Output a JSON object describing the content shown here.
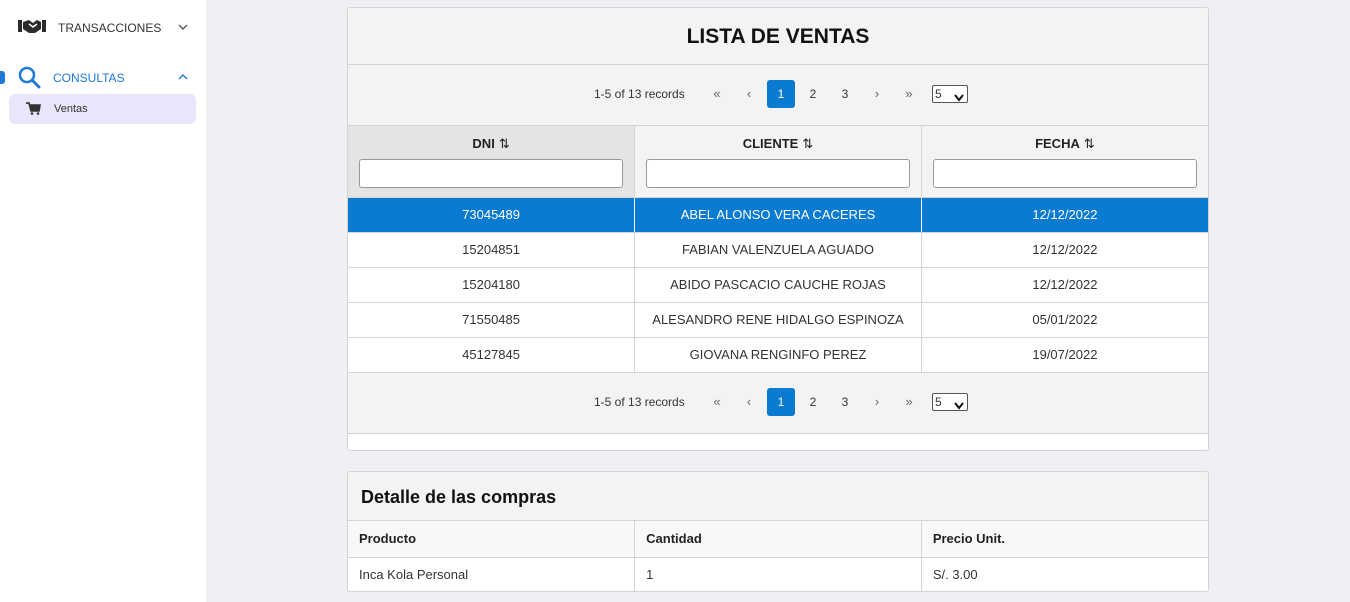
{
  "sidebar": {
    "transacciones": "TRANSACCIONES",
    "consultas": "CONSULTAS",
    "ventas": "Ventas"
  },
  "colors": {
    "accent": "#0b7ad1",
    "sidebar_active_bg": "#e8e6fb"
  },
  "sales": {
    "title": "LISTA DE VENTAS",
    "paginator": {
      "records": "1-5 of 13 records",
      "first": "«",
      "prev": "‹",
      "next": "›",
      "last": "»",
      "pages": [
        "1",
        "2",
        "3"
      ],
      "current_page": "1",
      "rows_per_page": "5"
    },
    "columns": [
      "DNI",
      "CLIENTE",
      "FECHA"
    ],
    "sort_icon": "⇅",
    "rows": [
      {
        "dni": "73045489",
        "cliente": "ABEL ALONSO VERA CACERES",
        "fecha": "12/12/2022",
        "selected": true
      },
      {
        "dni": "15204851",
        "cliente": "FABIAN VALENZUELA AGUADO",
        "fecha": "12/12/2022"
      },
      {
        "dni": "15204180",
        "cliente": "ABIDO PASCACIO CAUCHE ROJAS",
        "fecha": "12/12/2022"
      },
      {
        "dni": "71550485",
        "cliente": "ALESANDRO RENE HIDALGO ESPINOZA",
        "fecha": "05/01/2022"
      },
      {
        "dni": "45127845",
        "cliente": "GIOVANA RENGINFO PEREZ",
        "fecha": "19/07/2022"
      }
    ]
  },
  "detail": {
    "title": "Detalle de las compras",
    "columns": [
      "Producto",
      "Cantidad",
      "Precio Unit."
    ],
    "rows": [
      {
        "producto": "Inca Kola Personal",
        "cantidad": "1",
        "precio": "S/. 3.00"
      }
    ]
  }
}
